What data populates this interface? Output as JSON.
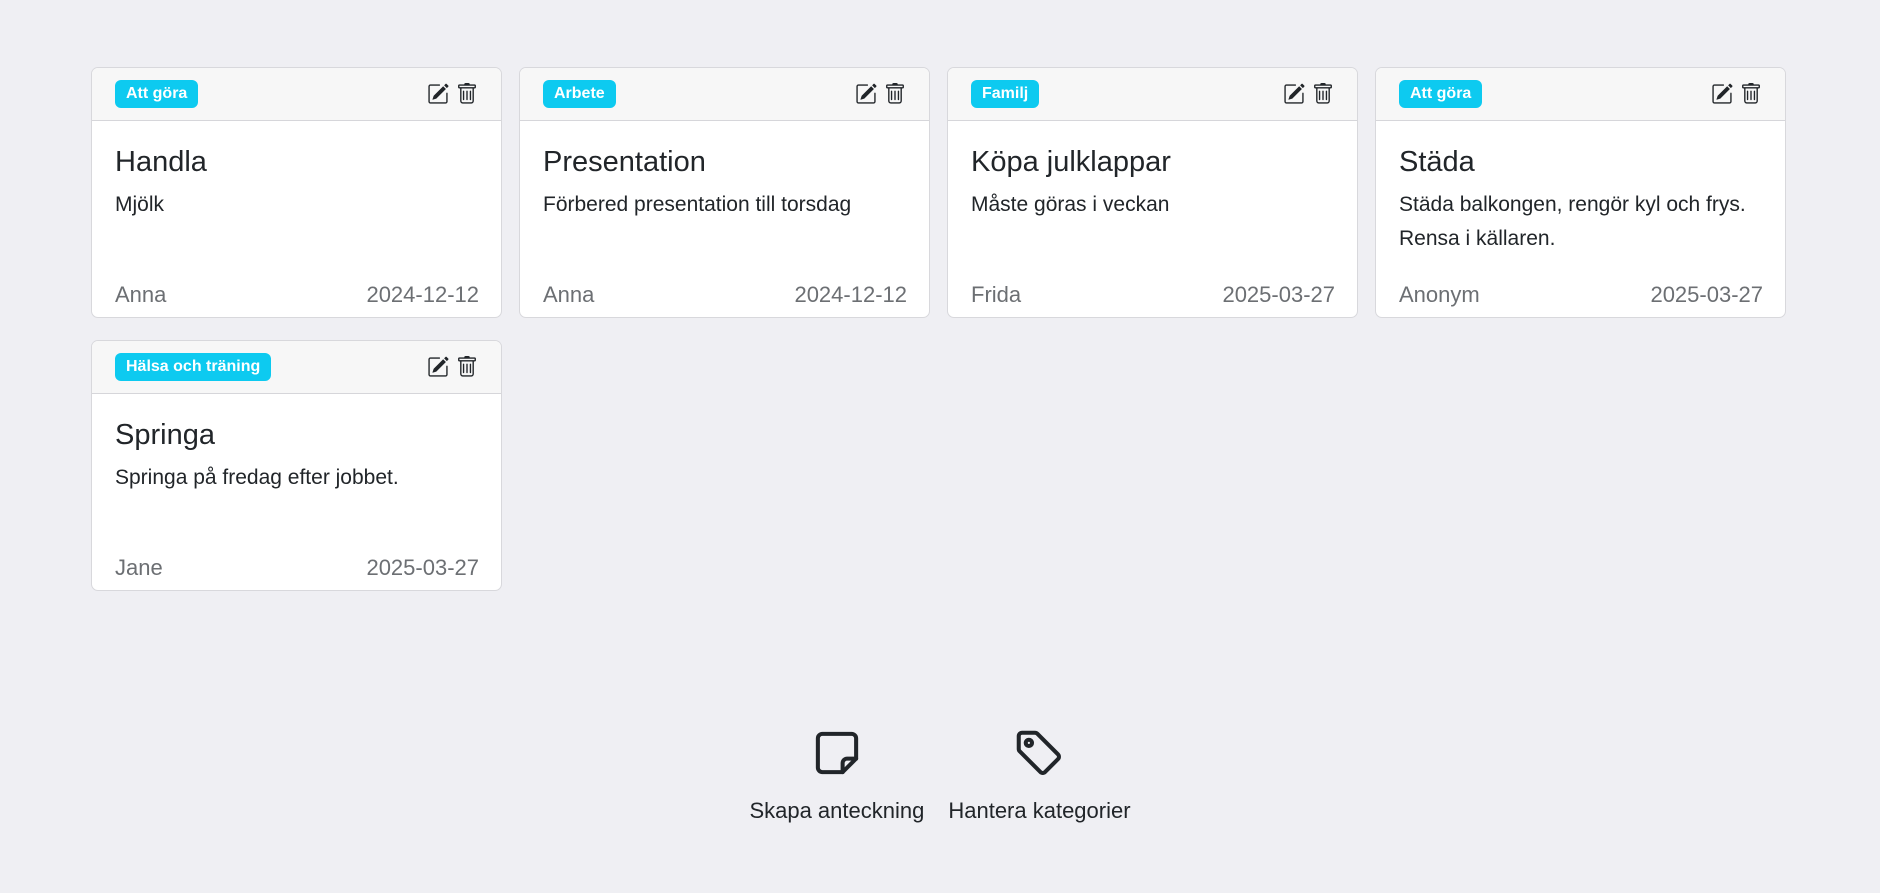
{
  "icons": {
    "edit": "pencil-square-icon",
    "delete": "trash-icon",
    "create": "sticky-note-icon",
    "categories": "tag-icon"
  },
  "colors": {
    "badge": "#0dcaf0",
    "background": "#efeff3"
  },
  "notes": [
    {
      "category": "Att göra",
      "title": "Handla",
      "text": "Mjölk",
      "author": "Anna",
      "date": "2024-12-12"
    },
    {
      "category": "Arbete",
      "title": "Presentation",
      "text": "Förbered presentation till torsdag",
      "author": "Anna",
      "date": "2024-12-12"
    },
    {
      "category": "Familj",
      "title": "Köpa julklappar",
      "text": "Måste göras i veckan",
      "author": "Frida",
      "date": "2025-03-27"
    },
    {
      "category": "Att göra",
      "title": "Städa",
      "text": "Städa balkongen, rengör kyl och frys. Rensa i källaren.",
      "author": "Anonym",
      "date": "2025-03-27"
    },
    {
      "category": "Hälsa och träning",
      "title": "Springa",
      "text": "Springa på fredag efter jobbet.",
      "author": "Jane",
      "date": "2025-03-27"
    }
  ],
  "actions": {
    "create_label": "Skapa anteckning",
    "categories_label": "Hantera kategorier"
  }
}
